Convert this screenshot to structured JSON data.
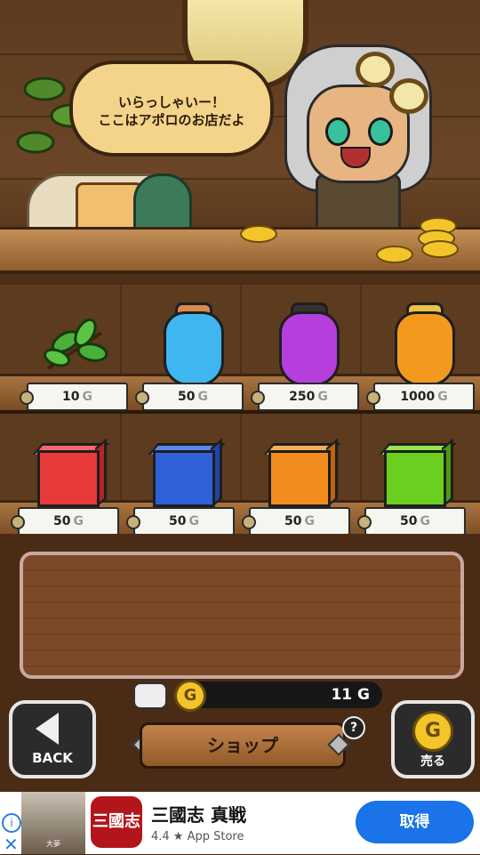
{
  "shopkeeper": {
    "speech_line1": "いらっしゃいー！",
    "speech_line2": "ここはアポロのお店だよ"
  },
  "shelf_top": [
    {
      "name": "herb",
      "price": "10",
      "unit": "G"
    },
    {
      "name": "blue-potion",
      "price": "50",
      "unit": "G",
      "color": "#3fb6f0"
    },
    {
      "name": "purple-potion",
      "price": "250",
      "unit": "G",
      "color": "#b43fdc"
    },
    {
      "name": "orange-potion",
      "price": "1000",
      "unit": "G",
      "color": "#f39a1e"
    }
  ],
  "shelf_bottom": [
    {
      "name": "red-block",
      "price": "50",
      "unit": "G",
      "color": "#e83a3a"
    },
    {
      "name": "blue-block",
      "price": "50",
      "unit": "G",
      "color": "#2f62d8"
    },
    {
      "name": "orange-block",
      "price": "50",
      "unit": "G",
      "color": "#f28c1c"
    },
    {
      "name": "green-block",
      "price": "50",
      "unit": "G",
      "color": "#6bcf1f"
    }
  ],
  "wallet": {
    "gold": "11",
    "unit": "G",
    "coin_symbol": "G"
  },
  "controls": {
    "back_label": "BACK",
    "shop_label": "ショップ",
    "help_label": "?",
    "sell_label": "売る",
    "sell_coin": "G"
  },
  "ad": {
    "info": "i",
    "close": "✕",
    "photo_caption": "大夢",
    "app_icon_text": "三國志",
    "title": "三國志 真戦",
    "rating": "4.4 ★ App Store",
    "cta": "取得"
  }
}
